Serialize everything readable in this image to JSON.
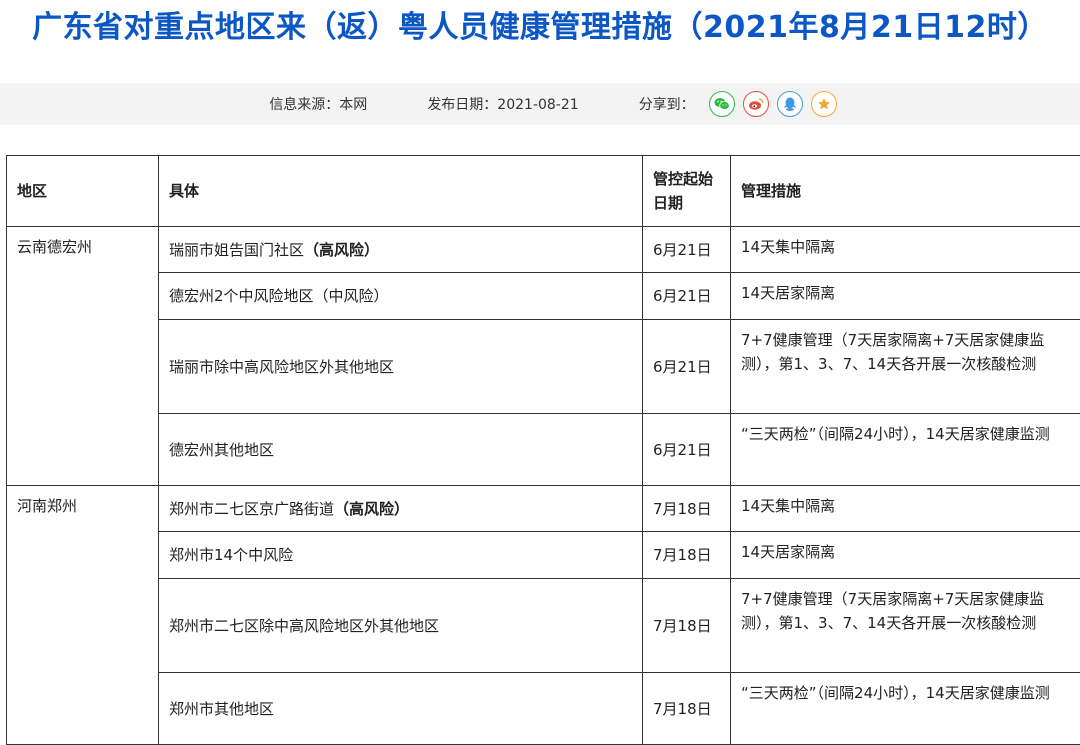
{
  "title": "广东省对重点地区来（返）粤人员健康管理措施（2021年8月21日12时）",
  "info": {
    "source": "信息来源：本网",
    "date": "发布日期：2021-08-21",
    "share_label": "分享到："
  },
  "share_icons": [
    "wechat-icon",
    "weibo-icon",
    "qq-icon",
    "star-icon"
  ],
  "colors": {
    "title": "#0b57c5",
    "wechat": "#2dbb3f",
    "weibo": "#e84c3d",
    "qq": "#3f9ae6",
    "favorite": "#f2a93b"
  },
  "table": {
    "headers": [
      "地区",
      "具体",
      "管控起始日期",
      "管理措施"
    ],
    "groups": [
      {
        "region": "云南德宏州",
        "rows": [
          {
            "specific": "瑞丽市姐告国门社区",
            "highlight": "（高风险）",
            "date": "6月21日",
            "measure": "14天集中隔离"
          },
          {
            "specific": "德宏州2个中风险地区（中风险）",
            "highlight": "",
            "date": "6月21日",
            "measure": "14天居家隔离"
          },
          {
            "specific": "瑞丽市除中高风险地区外其他地区",
            "highlight": "",
            "date": "6月21日",
            "measure": "7+7健康管理（7天居家隔离+7天居家健康监测），第1、3、7、14天各开展一次核酸检测"
          },
          {
            "specific": "德宏州其他地区",
            "highlight": "",
            "date": "6月21日",
            "measure": "“三天两检”（间隔24小时），14天居家健康监测"
          }
        ]
      },
      {
        "region": "河南郑州",
        "rows": [
          {
            "specific": "郑州市二七区京广路街道",
            "highlight": "（高风险）",
            "date": "7月18日",
            "measure": "14天集中隔离"
          },
          {
            "specific": "郑州市14个中风险",
            "highlight": "",
            "date": "7月18日",
            "measure": "14天居家隔离"
          },
          {
            "specific": "郑州市二七区除中高风险地区外其他地区",
            "highlight": "",
            "date": "7月18日",
            "measure": "7+7健康管理（7天居家隔离+7天居家健康监测），第1、3、7、14天各开展一次核酸检测"
          },
          {
            "specific": "郑州市其他地区",
            "highlight": "",
            "date": "7月18日",
            "measure": "“三天两检”（间隔24小时），14天居家健康监测"
          }
        ]
      }
    ]
  }
}
